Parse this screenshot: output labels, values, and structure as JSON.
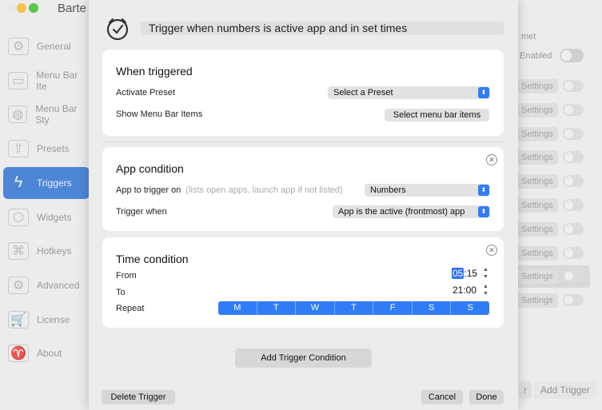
{
  "background": {
    "app_title": "Barte",
    "sidebar": [
      {
        "label": "General",
        "icon": "gear-icon",
        "glyph": "⚙"
      },
      {
        "label": "Menu Bar Ite",
        "icon": "menu-bar-items-icon",
        "glyph": "▭"
      },
      {
        "label": "Menu Bar Sty",
        "icon": "palette-icon",
        "glyph": "◍"
      },
      {
        "label": "Presets",
        "icon": "presets-icon",
        "glyph": "⇪"
      },
      {
        "label": "Triggers",
        "icon": "lightning-icon",
        "glyph": "ϟ"
      },
      {
        "label": "Widgets",
        "icon": "cube-icon",
        "glyph": "⬡"
      },
      {
        "label": "Hotkeys",
        "icon": "command-key-icon",
        "glyph": "⌘"
      },
      {
        "label": "Advanced",
        "icon": "advanced-gears-icon",
        "glyph": "⚙"
      },
      {
        "label": "License",
        "icon": "cart-icon",
        "glyph": "🛒"
      },
      {
        "label": "About",
        "icon": "about-icon",
        "glyph": "♈"
      }
    ],
    "active_sidebar_index": 4,
    "right_header": "met",
    "enabled_label": "Enabled",
    "settings_label": "Settings",
    "add_trigger": "Add Trigger",
    "bottom_partial": "r"
  },
  "sheet": {
    "title": "Trigger when numbers is active app and in set times",
    "when_triggered": {
      "title": "When triggered",
      "activate_preset_label": "Activate Preset",
      "activate_preset_value": "Select a Preset",
      "show_menu_bar_items_label": "Show Menu Bar Items",
      "select_items_button": "Select menu bar items"
    },
    "app_condition": {
      "title": "App condition",
      "app_to_trigger_label": "App to trigger on",
      "app_to_trigger_hint": "(lists open apps, launch app if not listed)",
      "app_value": "Numbers",
      "trigger_when_label": "Trigger when",
      "trigger_when_value": "App is the active (frontmost) app"
    },
    "time_condition": {
      "title": "Time condition",
      "from_label": "From",
      "from_hour": "05",
      "from_minute": ":15",
      "to_label": "To",
      "to_value": "21:00",
      "repeat_label": "Repeat",
      "days": [
        "M",
        "T",
        "W",
        "T",
        "F",
        "S",
        "S"
      ]
    },
    "add_trigger_condition": "Add Trigger Condition",
    "delete_trigger": "Delete Trigger",
    "cancel": "Cancel",
    "done": "Done"
  },
  "colors": {
    "accent": "#2f7cf6",
    "sidebar_active": "#4e86d6"
  }
}
